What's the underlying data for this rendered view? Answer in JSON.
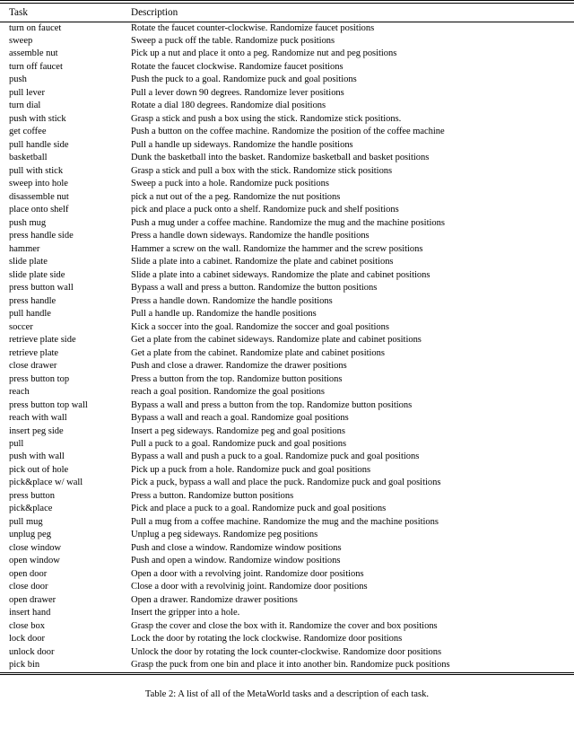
{
  "table": {
    "columns": [
      "Task",
      "Description"
    ],
    "rows": [
      [
        "turn on faucet",
        "Rotate the faucet counter-clockwise. Randomize faucet positions"
      ],
      [
        "sweep",
        "Sweep a puck off the table. Randomize puck positions"
      ],
      [
        "assemble nut",
        "Pick up a nut and place it onto a peg. Randomize nut and peg positions"
      ],
      [
        "turn off faucet",
        "Rotate the faucet clockwise. Randomize faucet positions"
      ],
      [
        "push",
        "Push the puck to a goal. Randomize puck and goal positions"
      ],
      [
        "pull lever",
        "Pull a lever down 90 degrees. Randomize lever positions"
      ],
      [
        "turn dial",
        "Rotate a dial 180 degrees. Randomize dial positions"
      ],
      [
        "push with stick",
        "Grasp a stick and push a box using the stick. Randomize stick positions."
      ],
      [
        "get coffee",
        "Push a button on the coffee machine. Randomize the position of the coffee machine"
      ],
      [
        "pull handle side",
        "Pull a handle up sideways. Randomize the handle positions"
      ],
      [
        "basketball",
        "Dunk the basketball into the basket. Randomize basketball and basket positions"
      ],
      [
        "pull with stick",
        "Grasp a stick and pull a box with the stick. Randomize stick positions"
      ],
      [
        "sweep into hole",
        "Sweep a puck into a hole. Randomize puck positions"
      ],
      [
        "disassemble nut",
        "pick a nut out of the a peg. Randomize the nut positions"
      ],
      [
        "place onto shelf",
        "pick and place a puck onto a shelf. Randomize puck and shelf positions"
      ],
      [
        "push mug",
        "Push a mug under a coffee machine. Randomize the mug and the machine positions"
      ],
      [
        "press handle side",
        "Press a handle down sideways. Randomize the handle positions"
      ],
      [
        "hammer",
        "Hammer a screw on the wall. Randomize the hammer and the screw positions"
      ],
      [
        "slide plate",
        "Slide a plate into a cabinet. Randomize the plate and cabinet positions"
      ],
      [
        "slide plate side",
        "Slide a plate into a cabinet sideways. Randomize the plate and cabinet positions"
      ],
      [
        "press button wall",
        "Bypass a wall and press a button. Randomize the button positions"
      ],
      [
        "press handle",
        "Press a handle down. Randomize the handle positions"
      ],
      [
        "pull handle",
        "Pull a handle up. Randomize the handle positions"
      ],
      [
        "soccer",
        "Kick a soccer into the goal. Randomize the soccer and goal positions"
      ],
      [
        "retrieve plate side",
        "Get a plate from the cabinet sideways. Randomize plate and cabinet positions"
      ],
      [
        "retrieve plate",
        "Get a plate from the cabinet. Randomize plate and cabinet positions"
      ],
      [
        "close drawer",
        "Push and close a drawer. Randomize the drawer positions"
      ],
      [
        "press button top",
        "Press a button from the top. Randomize button positions"
      ],
      [
        "reach",
        "reach a goal position. Randomize the goal positions"
      ],
      [
        "press button top wall",
        "Bypass a wall and press a button from the top. Randomize button positions"
      ],
      [
        "reach with wall",
        "Bypass a wall and reach a goal. Randomize goal positions"
      ],
      [
        "insert peg side",
        "Insert a peg sideways. Randomize peg and goal positions"
      ],
      [
        "pull",
        "Pull a puck to a goal. Randomize puck and goal positions"
      ],
      [
        "push with wall",
        "Bypass a wall and push a puck to a goal. Randomize puck and goal positions"
      ],
      [
        "pick out of hole",
        "Pick up a puck from a hole. Randomize puck and goal positions"
      ],
      [
        "pick&place w/ wall",
        "Pick a puck, bypass a wall and place the puck. Randomize puck and goal positions"
      ],
      [
        "press button",
        "Press a button. Randomize button positions"
      ],
      [
        "pick&place",
        "Pick and place a puck to a goal. Randomize puck and goal positions"
      ],
      [
        "pull mug",
        "Pull a mug from a coffee machine. Randomize the mug and the machine positions"
      ],
      [
        "unplug peg",
        "Unplug a peg sideways. Randomize peg positions"
      ],
      [
        "close window",
        "Push and close a window. Randomize window positions"
      ],
      [
        "open window",
        "Push and open a window. Randomize window positions"
      ],
      [
        "open door",
        "Open a door with a revolving joint. Randomize door positions"
      ],
      [
        "close door",
        "Close a door with a revolvinig joint. Randomize door positions"
      ],
      [
        "open drawer",
        "Open a drawer. Randomize drawer positions"
      ],
      [
        "insert hand",
        "Insert the gripper into a hole."
      ],
      [
        "close box",
        "Grasp the cover and close the box with it. Randomize the cover and box positions"
      ],
      [
        "lock door",
        "Lock the door by rotating the lock clockwise. Randomize door positions"
      ],
      [
        "unlock door",
        "Unlock the door by rotating the lock counter-clockwise. Randomize door positions"
      ],
      [
        "pick bin",
        "Grasp the puck from one bin and place it into another bin. Randomize puck positions"
      ]
    ]
  },
  "caption": "Table 2: A list of all of the MetaWorld tasks and a description of each task."
}
